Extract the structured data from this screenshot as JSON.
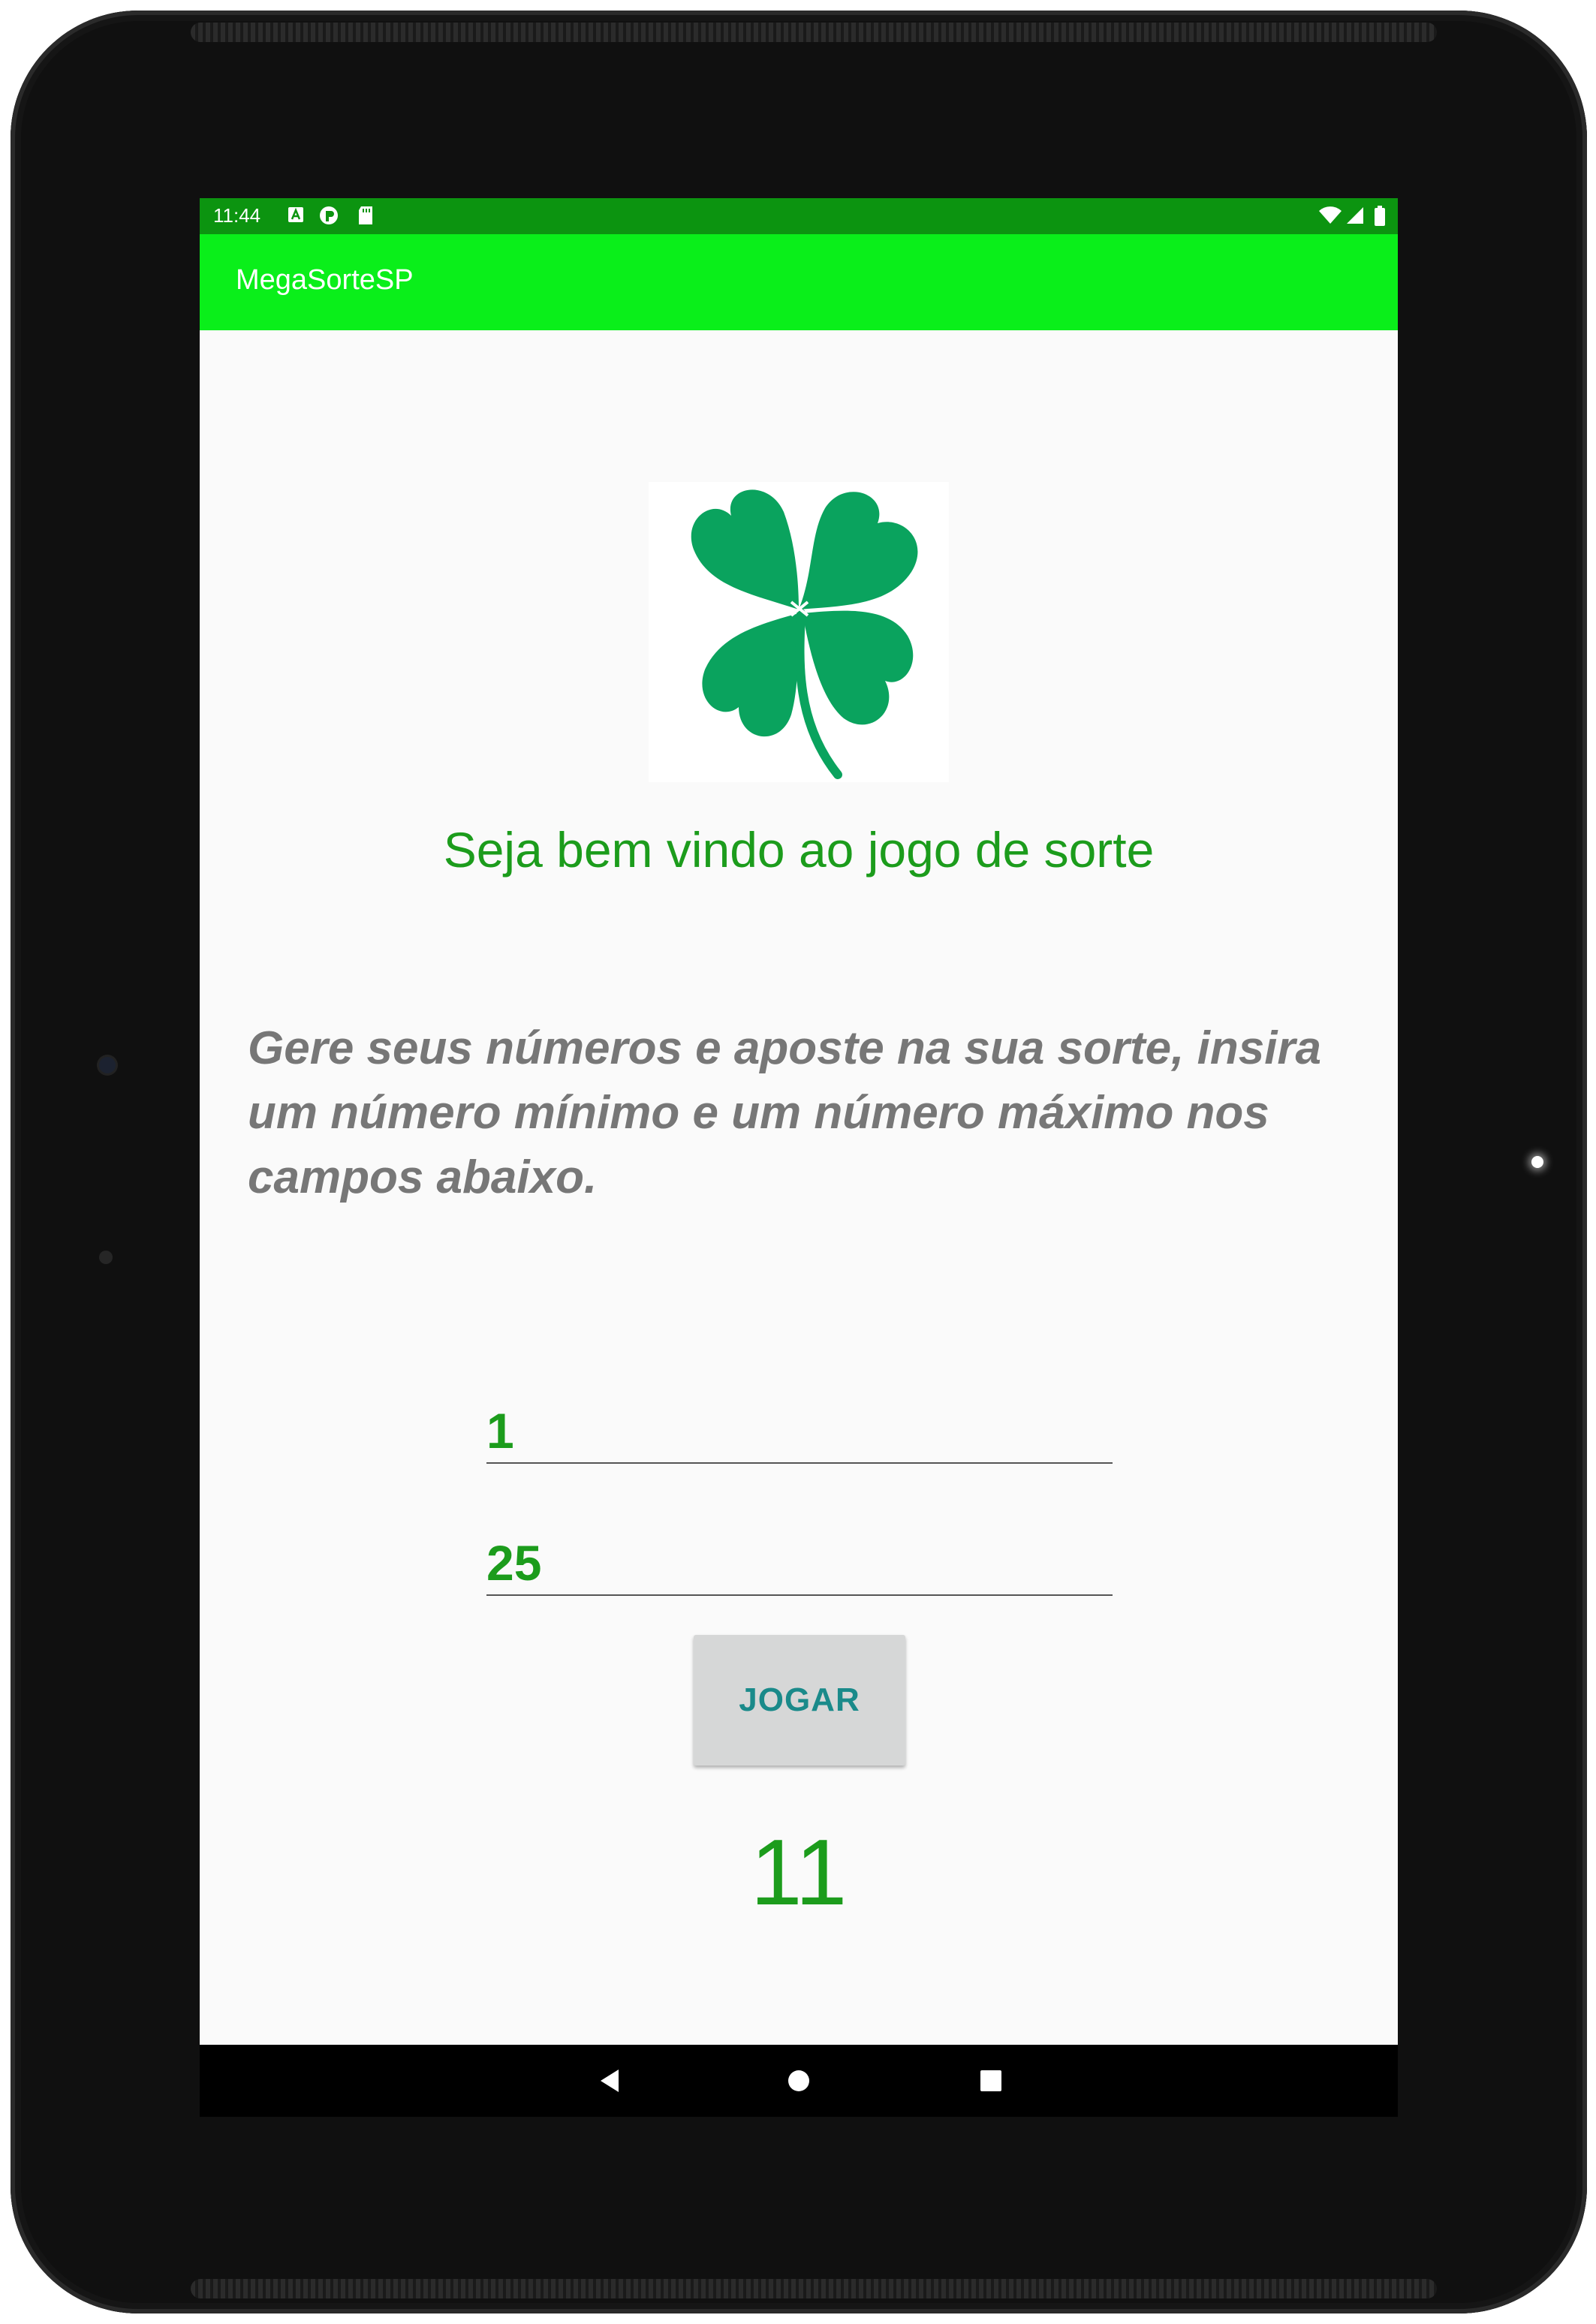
{
  "status_bar": {
    "time": "11:44"
  },
  "app_bar": {
    "title": "MegaSorteSP"
  },
  "main": {
    "welcome_text": "Seja bem vindo ao jogo de sorte",
    "instructions": "Gere seus números e aposte na sua sorte, insira um número mínimo e um número máximo nos campos abaixo.",
    "min_field_value": "1",
    "max_field_value": "25",
    "play_button_label": "JOGAR",
    "result_value": "11"
  },
  "icons": {
    "clover": "clover-icon",
    "nav_back": "back-icon",
    "nav_home": "home-icon",
    "nav_recents": "recents-icon"
  },
  "colors": {
    "status_bar": "#0c9410",
    "app_bar": "#0aef1a",
    "accent_text": "#1c9c1c",
    "clover": "#0aa35e",
    "button_text": "#1a8a8a"
  }
}
